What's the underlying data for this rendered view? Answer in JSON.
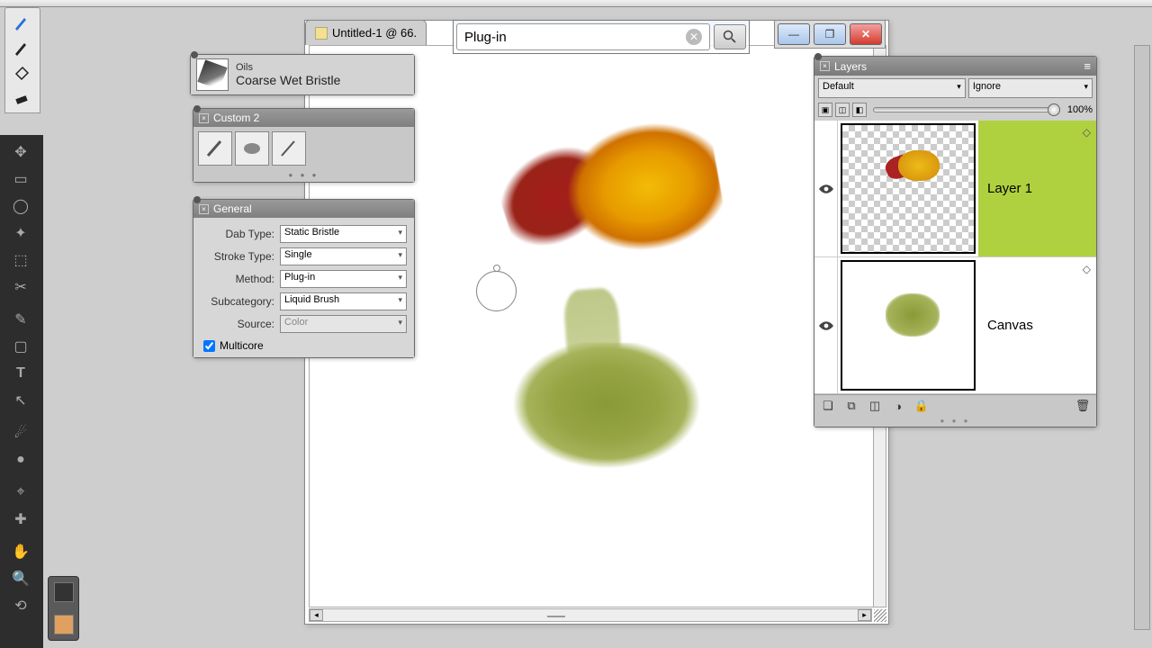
{
  "doc": {
    "title": "Untitled-1 @ 66."
  },
  "search": {
    "value": "Plug-in",
    "placeholder": ""
  },
  "brush_info": {
    "category": "Oils",
    "name": "Coarse Wet Bristle"
  },
  "custom_panel": {
    "title": "Custom 2"
  },
  "general_panel": {
    "title": "General",
    "rows": {
      "dab_type": {
        "label": "Dab Type:",
        "value": "Static Bristle"
      },
      "stroke_type": {
        "label": "Stroke Type:",
        "value": "Single"
      },
      "method": {
        "label": "Method:",
        "value": "Plug-in"
      },
      "subcategory": {
        "label": "Subcategory:",
        "value": "Liquid Brush"
      },
      "source": {
        "label": "Source:",
        "value": "Color"
      }
    },
    "multicore": {
      "label": "Multicore",
      "checked": true
    }
  },
  "layers_panel": {
    "title": "Layers",
    "blend": "Default",
    "preserve": "Ignore",
    "opacity": "100%",
    "layers": [
      {
        "name": "Layer 1",
        "selected": true,
        "transparent": true
      },
      {
        "name": "Canvas",
        "selected": false,
        "transparent": false
      }
    ]
  },
  "winctrl": {
    "min": "—",
    "max": "❐",
    "close": "✕"
  }
}
